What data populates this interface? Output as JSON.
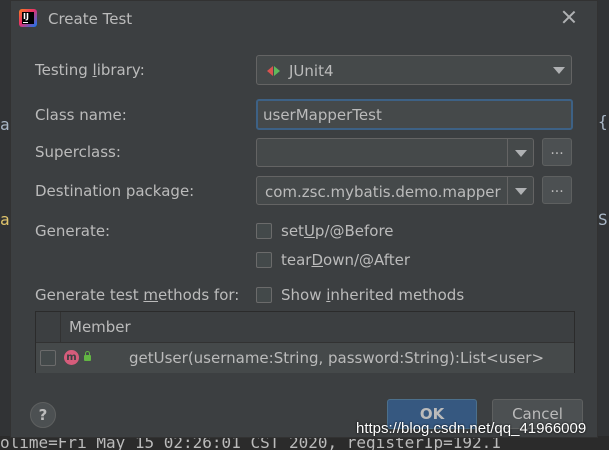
{
  "dialog": {
    "title": "Create Test",
    "testing_library_label": "Testing library:",
    "testing_library_value": "JUnit4",
    "class_name_label": "Class name:",
    "class_name_value": "userMapperTest",
    "superclass_label": "Superclass:",
    "superclass_value": "",
    "destination_label": "Destination package:",
    "destination_value": "com.zsc.mybatis.demo.mapper",
    "ellipsis": "...",
    "generate_label": "Generate:",
    "setup_label": "setUp/@Before",
    "teardown_label": "tearDown/@After",
    "methods_label": "Generate test methods for:",
    "show_inherited_label": "Show inherited methods",
    "table_header": "Member",
    "member_row": "getUser(username:String, password:String):List<user>",
    "method_icon_letter": "m",
    "help_symbol": "?",
    "ok_label": "OK",
    "cancel_label": "Cancel"
  },
  "background": {
    "bottom_code": "olime=Fri May 15 02:26:01 CST 2020, registerIp=192.1",
    "watermark": "https://blog.csdn.net/qq_41966009",
    "left_chars": [
      "a",
      "a"
    ],
    "right_chars": [
      "{",
      "S"
    ]
  },
  "checkbox_states": {
    "setup": false,
    "teardown": false,
    "show_inherited": false,
    "member": false
  },
  "colors": {
    "dialog_bg": "#3c3f41",
    "accent": "#365880",
    "focus_border": "#3d6185",
    "junit_red": "#d9534f",
    "junit_green": "#5fb85c"
  }
}
